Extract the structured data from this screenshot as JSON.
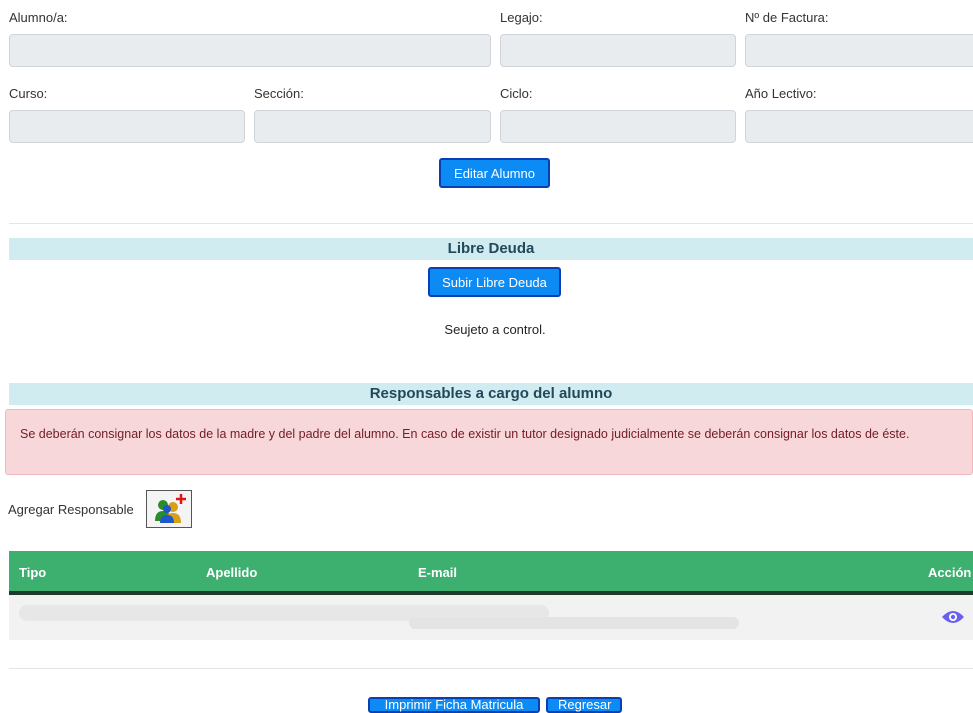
{
  "student": {
    "alumno_label": "Alumno/a:",
    "legajo_label": "Legajo:",
    "factura_label": "Nº de Factura:",
    "curso_label": "Curso:",
    "seccion_label": "Sección:",
    "ciclo_label": "Ciclo:",
    "anio_label": "Año Lectivo:",
    "edit_button": "Editar Alumno"
  },
  "libre_deuda": {
    "title": "Libre Deuda",
    "upload_button": "Subir Libre Deuda",
    "status_text": "Seujeto a control."
  },
  "responsables": {
    "title": "Responsables a cargo del alumno",
    "alert_text": "Se deberán consignar los datos de la madre y del padre del alumno. En caso de existir un tutor designado judicialmente se deberán consignar los datos de éste.",
    "add_label": "Agregar Responsable",
    "add_icon": "add-user-icon",
    "table": {
      "headers": [
        "Tipo",
        "Apellido",
        "E-mail",
        "Acción"
      ],
      "row_action_icon": "eye-icon"
    }
  },
  "footer": {
    "print_button": "Imprimir Ficha Matricula",
    "back_button": "Regresar"
  },
  "colors": {
    "button": "#0d8bf5",
    "section_header": "#d1ecf1",
    "alert_bg": "#f8d7da",
    "table_header": "#3daf6f",
    "eye_icon": "#6b5ff0"
  }
}
